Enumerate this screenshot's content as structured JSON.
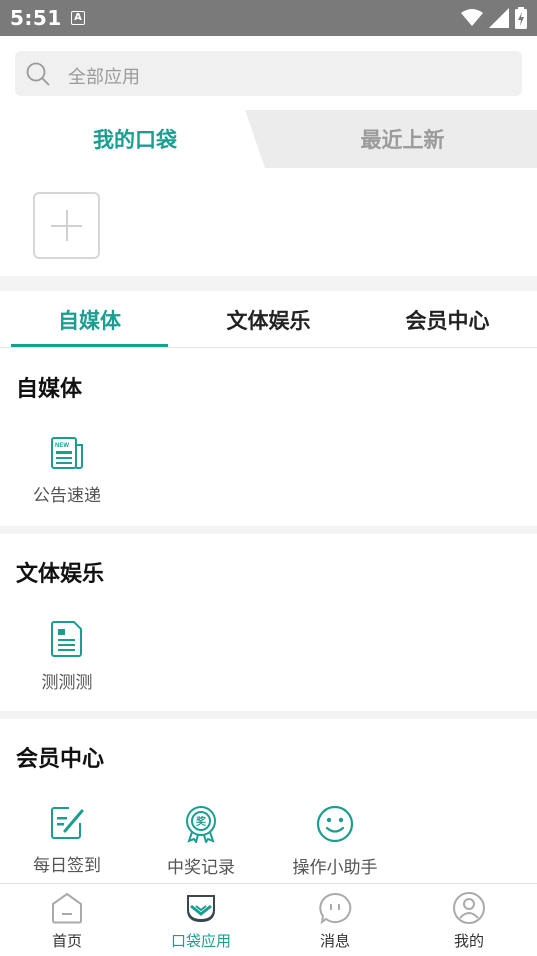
{
  "status": {
    "time": "5:51",
    "badge": "A"
  },
  "search": {
    "placeholder": "全部应用"
  },
  "pocket_tabs": {
    "mine": "我的口袋",
    "recent": "最近上新"
  },
  "category_tabs": [
    "自媒体",
    "文体娱乐",
    "会员中心"
  ],
  "sections": [
    {
      "title": "自媒体",
      "apps": [
        {
          "label": "公告速递",
          "icon": "news-icon"
        }
      ]
    },
    {
      "title": "文体娱乐",
      "apps": [
        {
          "label": "测测测",
          "icon": "document-icon"
        }
      ]
    },
    {
      "title": "会员中心",
      "apps": [
        {
          "label": "每日签到",
          "icon": "edit-icon"
        },
        {
          "label": "中奖记录",
          "icon": "award-icon"
        },
        {
          "label": "操作小助手",
          "icon": "smiley-icon"
        }
      ]
    }
  ],
  "bottom_nav": [
    {
      "label": "首页",
      "icon": "home-icon"
    },
    {
      "label": "口袋应用",
      "icon": "pocket-icon"
    },
    {
      "label": "消息",
      "icon": "message-icon"
    },
    {
      "label": "我的",
      "icon": "profile-icon"
    }
  ],
  "colors": {
    "accent": "#1a9e92",
    "statusbar": "#7a7a7a"
  }
}
